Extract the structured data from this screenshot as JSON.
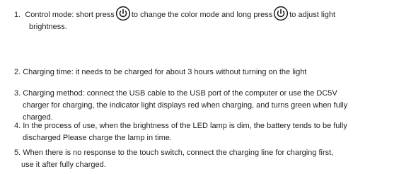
{
  "items": [
    {
      "num": "1.",
      "line1_a": "Control mode:  short press",
      "line1_b": "to change the color mode and long press",
      "line1_c": "to adjust light",
      "line2": "brightness."
    },
    {
      "text": "2. Charging time: it needs to be charged for about 3 hours without turning on the light"
    },
    {
      "line1": "3. Charging method: connect the USB cable to the USB port of the computer or use the DC5V",
      "line2": "charger for charging, the indicator light displays red when charging, and turns green when fully",
      "line3": "charged."
    },
    {
      "line1": "4. In the process of use, when the brightness of the LED lamp is dim, the battery tends to be fully",
      "line2": "discharged Please charge the lamp in time."
    },
    {
      "line1": "5. When there is no response to the touch switch, connect the charging line for charging first,",
      "line2": "use it after fully charged."
    }
  ],
  "icons": {
    "power": "power-icon"
  }
}
